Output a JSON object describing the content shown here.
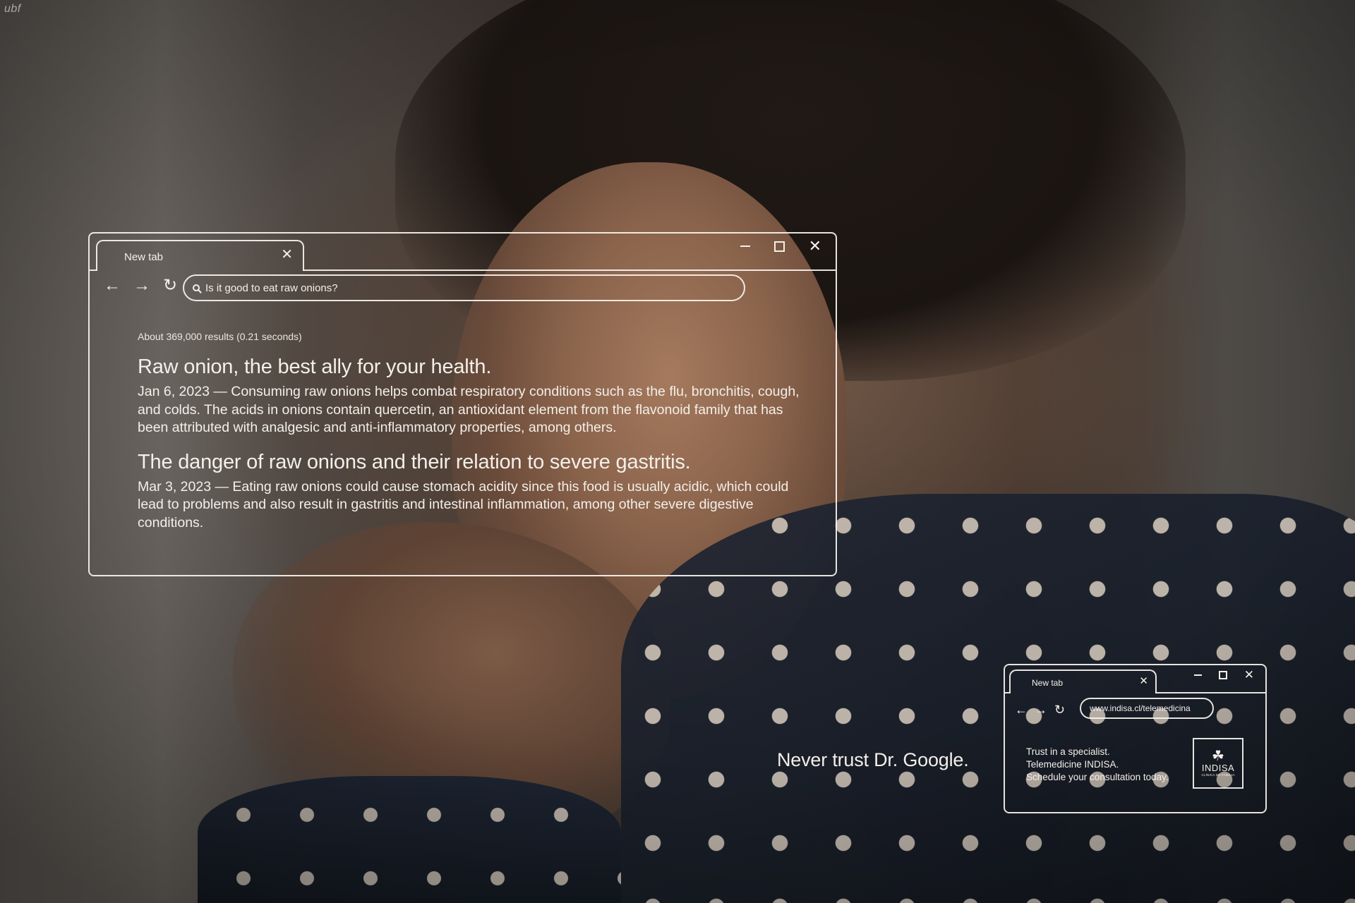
{
  "corner_logo": "ubf",
  "main_window": {
    "tab_label": "New tab",
    "tab_close": "✕",
    "controls": {
      "minimize": "–",
      "close": "✕"
    },
    "nav": {
      "back": "←",
      "forward": "→",
      "reload": "↻"
    },
    "search_query": "Is it good to eat raw onions?",
    "results_stats": "About 369,000 results (0.21 seconds)",
    "results": [
      {
        "title": "Raw onion, the best ally for your health.",
        "snippet": "Jan 6, 2023 — Consuming raw onions helps combat respiratory conditions such as the flu, bronchitis, cough, and colds. The acids in onions contain quercetin, an antioxidant element from the flavonoid family that has been attributed with analgesic and anti-inflammatory properties, among others."
      },
      {
        "title": "The danger of raw onions and their relation to severe gastritis.",
        "snippet": "Mar 3, 2023 — Eating raw onions could cause stomach acidity since this food is usually acidic, which could lead to problems and also result in gastritis and intestinal inflammation, among other severe digestive conditions."
      }
    ]
  },
  "small_window": {
    "tab_label": "New tab",
    "tab_close": "✕",
    "controls": {
      "minimize": "–",
      "close": "✕"
    },
    "nav": {
      "back": "←",
      "forward": "→",
      "reload": "↻"
    },
    "url": "www.indisa.cl/telemedicina",
    "cta_lines": [
      "Trust in a specialist.",
      "Telemedicine INDISA.",
      "Schedule your consultation today."
    ],
    "brand": {
      "glyph": "☘",
      "name": "INDISA",
      "sub": "CLÍNICA DE FAMILIA"
    }
  },
  "tagline": "Never trust Dr. Google.",
  "icons": [
    "search-icon",
    "back-arrow-icon",
    "forward-arrow-icon",
    "reload-icon",
    "minimize-icon",
    "maximize-icon",
    "close-icon"
  ]
}
